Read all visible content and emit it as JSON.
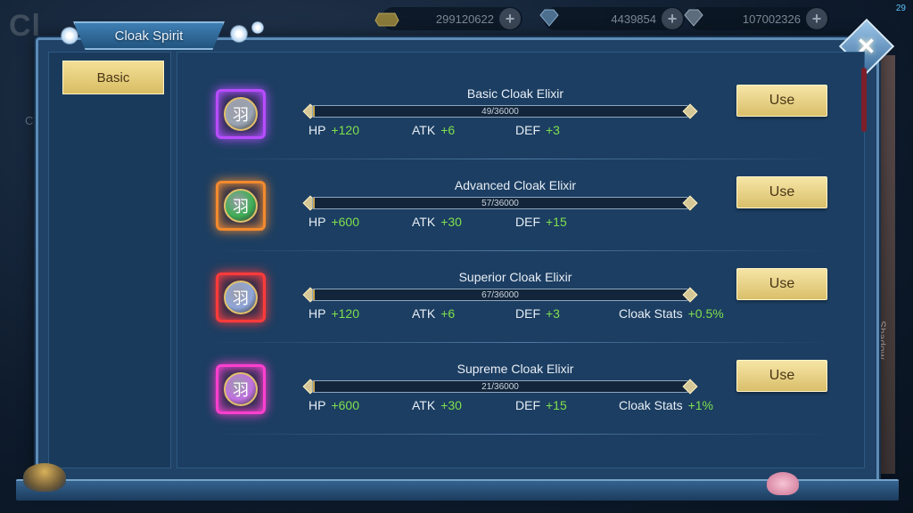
{
  "hud": {
    "bg_title": "Cl",
    "bg_side_label": "Clo",
    "fps": "29",
    "currencies": [
      {
        "icon": "gold-ingot-icon",
        "value": "299120622"
      },
      {
        "icon": "diamond-icon",
        "value": "4439854"
      },
      {
        "icon": "bound-diamond-icon",
        "value": "107002326"
      }
    ],
    "right_tab_label": "Shadow"
  },
  "panel": {
    "title": "Cloak Spirit",
    "close_symbol": "✕",
    "tabs": [
      {
        "label": "Basic",
        "active": true
      }
    ]
  },
  "items": [
    {
      "name": "Basic Cloak Elixir",
      "progress_text": "49/36000",
      "progress_value": 49,
      "progress_max": 36000,
      "rarity_color": "#b84cff",
      "orb_color": "#9aa4b2",
      "stats": [
        {
          "label": "HP",
          "value": "+120"
        },
        {
          "label": "ATK",
          "value": "+6"
        },
        {
          "label": "DEF",
          "value": "+3"
        }
      ],
      "use_label": "Use"
    },
    {
      "name": "Advanced Cloak Elixir",
      "progress_text": "57/36000",
      "progress_value": 57,
      "progress_max": 36000,
      "rarity_color": "#f28a2e",
      "orb_color": "#3fae56",
      "stats": [
        {
          "label": "HP",
          "value": "+600"
        },
        {
          "label": "ATK",
          "value": "+30"
        },
        {
          "label": "DEF",
          "value": "+15"
        }
      ],
      "use_label": "Use"
    },
    {
      "name": "Superior Cloak Elixir",
      "progress_text": "67/36000",
      "progress_value": 67,
      "progress_max": 36000,
      "rarity_color": "#ff3b3b",
      "orb_color": "#8fa6d8",
      "stats": [
        {
          "label": "HP",
          "value": "+120"
        },
        {
          "label": "ATK",
          "value": "+6"
        },
        {
          "label": "DEF",
          "value": "+3"
        },
        {
          "label": "Cloak Stats",
          "value": "+0.5%"
        }
      ],
      "use_label": "Use"
    },
    {
      "name": "Supreme Cloak Elixir",
      "progress_text": "21/36000",
      "progress_value": 21,
      "progress_max": 36000,
      "rarity_color": "#ff3fcf",
      "orb_color": "#c070e0",
      "stats": [
        {
          "label": "HP",
          "value": "+600"
        },
        {
          "label": "ATK",
          "value": "+30"
        },
        {
          "label": "DEF",
          "value": "+15"
        },
        {
          "label": "Cloak Stats",
          "value": "+1%"
        }
      ],
      "use_label": "Use"
    }
  ],
  "item_glyph": "羽",
  "colors": {
    "stat_value": "#7fe04d",
    "button_gold": "#e8d183",
    "panel_blue": "#1f4266"
  }
}
